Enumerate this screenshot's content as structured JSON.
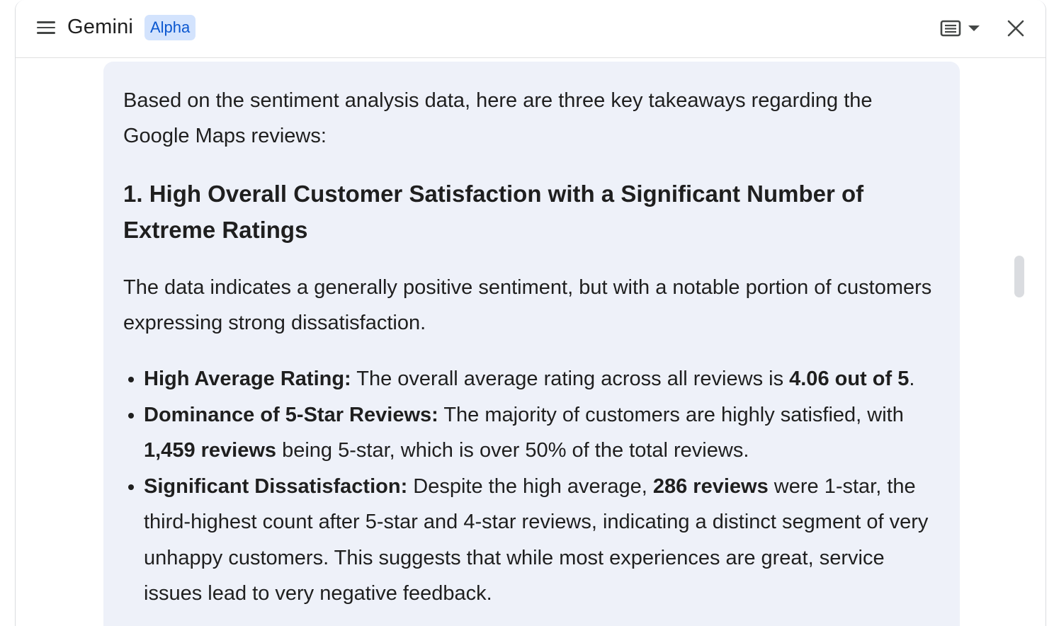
{
  "header": {
    "app_title": "Gemini",
    "badge": "Alpha",
    "icons": {
      "menu": "menu-icon",
      "view": "view-toggle-icon",
      "dropdown": "caret-down-icon",
      "close": "close-icon"
    }
  },
  "message": {
    "intro": "Based on the sentiment analysis data, here are three key takeaways regarding the Google Maps reviews:",
    "section_heading": "1. High Overall Customer Satisfaction with a Significant Number of Extreme Ratings",
    "section_paragraph": "The data indicates a generally positive sentiment, but with a notable portion of customers expressing strong dissatisfaction.",
    "bullets": [
      {
        "label": "High Average Rating:",
        "text_before": " The overall average rating across all reviews is ",
        "bold": "4.06 out of 5",
        "text_after": "."
      },
      {
        "label": "Dominance of 5-Star Reviews:",
        "text_before": " The majority of customers are highly satisfied, with ",
        "bold": "1,459 reviews",
        "text_after": " being 5-star, which is over 50% of the total reviews."
      },
      {
        "label": "Significant Dissatisfaction:",
        "text_before": " Despite the high average, ",
        "bold": "286 reviews",
        "text_after": " were 1-star, the third-highest count after 5-star and 4-star reviews, indicating a distinct segment of very unhappy customers. This suggests that while most experiences are great, service issues lead to very negative feedback."
      }
    ]
  },
  "colors": {
    "bubble_background": "#eef1f9",
    "badge_background": "#d3e3fd",
    "badge_text": "#0b57d0",
    "text": "#1f1f1f"
  }
}
